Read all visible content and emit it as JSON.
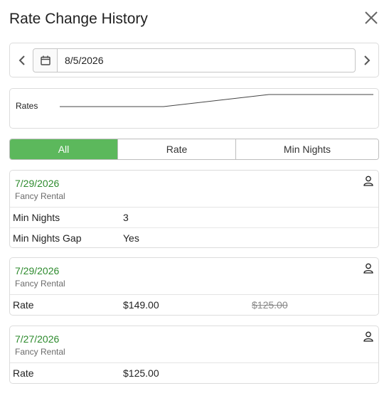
{
  "dialog": {
    "title": "Rate Change History"
  },
  "date_nav": {
    "value": "8/5/2026"
  },
  "sparkline": {
    "label": "Rates",
    "points": [
      {
        "date": "7/27/2026",
        "rate": 125.0
      },
      {
        "date": "7/29/2026",
        "rate": 125.0
      },
      {
        "date": "7/29/2026",
        "rate": 149.0
      },
      {
        "date": "8/5/2026",
        "rate": 149.0
      }
    ]
  },
  "tabs": [
    {
      "label": "All",
      "active": true
    },
    {
      "label": "Rate",
      "active": false
    },
    {
      "label": "Min Nights",
      "active": false
    }
  ],
  "entries": [
    {
      "date": "7/29/2026",
      "property": "Fancy Rental",
      "rows": [
        {
          "field": "Min Nights",
          "new": "3",
          "old": ""
        },
        {
          "field": "Min Nights Gap",
          "new": "Yes",
          "old": ""
        }
      ]
    },
    {
      "date": "7/29/2026",
      "property": "Fancy Rental",
      "rows": [
        {
          "field": "Rate",
          "new": "$149.00",
          "old": "$125.00"
        }
      ]
    },
    {
      "date": "7/27/2026",
      "property": "Fancy Rental",
      "rows": [
        {
          "field": "Rate",
          "new": "$125.00",
          "old": ""
        }
      ]
    }
  ],
  "colors": {
    "accent": "#5cb85c",
    "date_text": "#2e8b2e"
  },
  "icons": {
    "close": "close-icon",
    "prev": "chevron-left-icon",
    "next": "chevron-right-icon",
    "calendar": "calendar-icon",
    "user": "user-icon"
  }
}
